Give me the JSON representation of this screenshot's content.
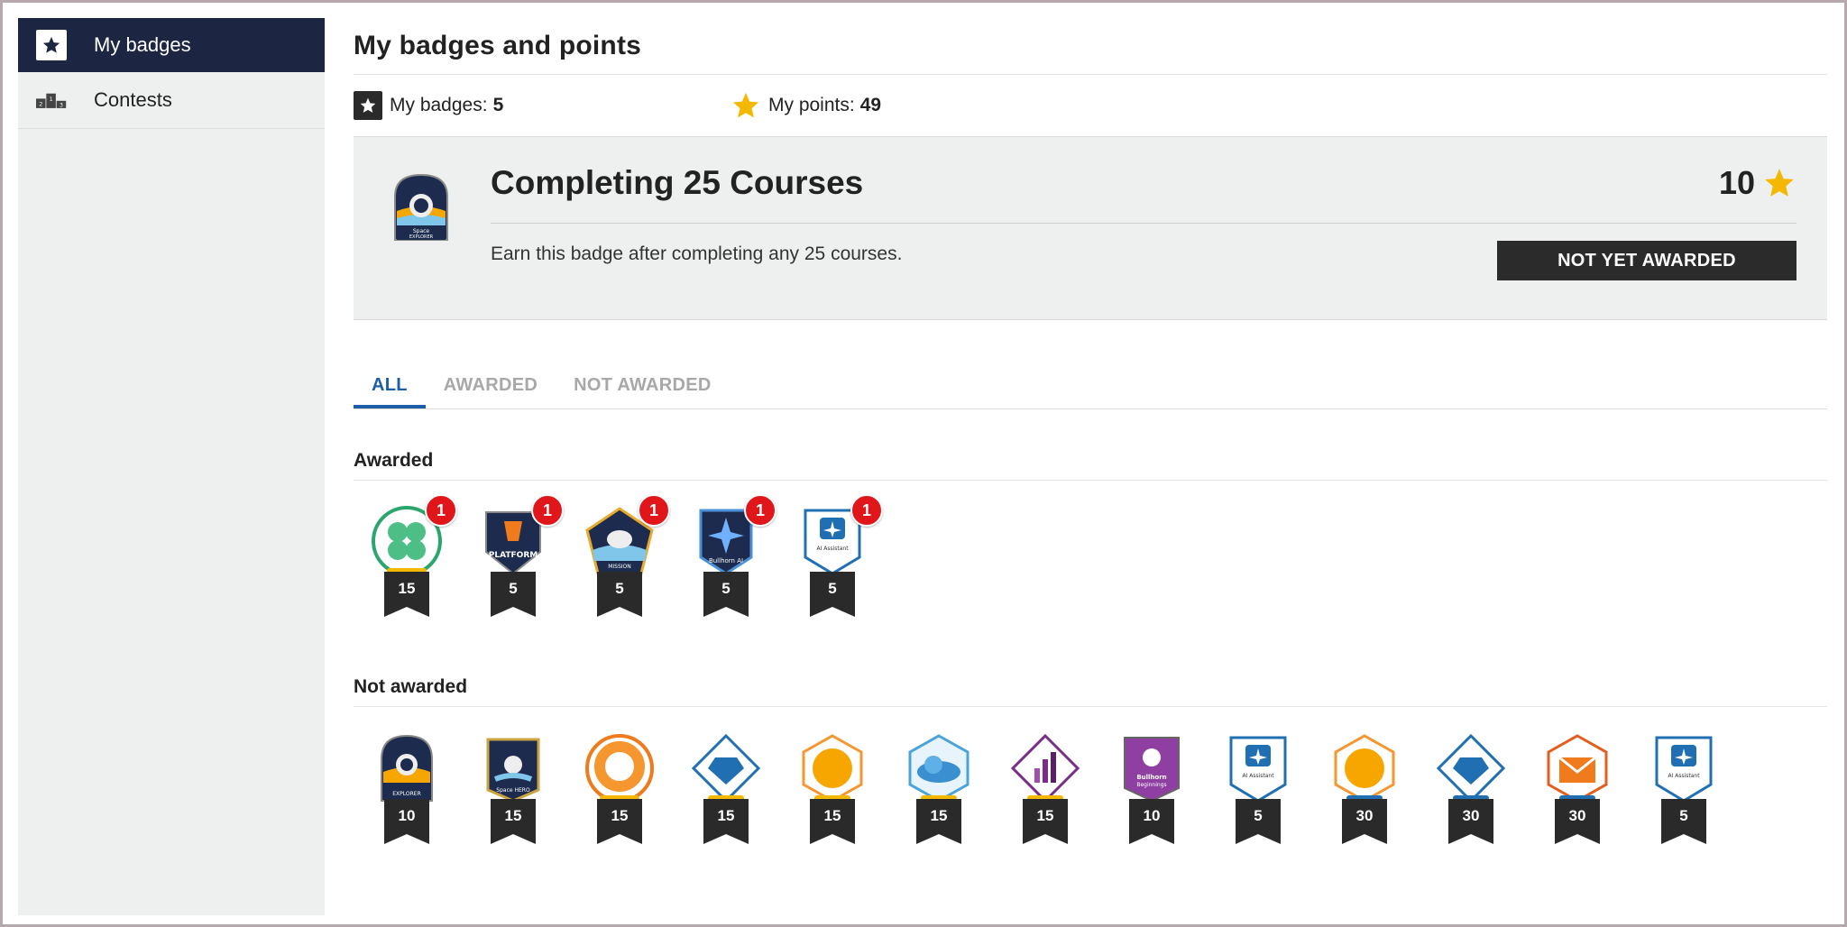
{
  "sidebar": {
    "items": [
      {
        "label": "My badges",
        "icon": "star-badge-icon",
        "active": true
      },
      {
        "label": "Contests",
        "icon": "podium-icon",
        "active": false
      }
    ]
  },
  "header": {
    "title": "My badges and points"
  },
  "stats": {
    "badges_label": "My badges:",
    "badges_value": "5",
    "points_label": "My points:",
    "points_value": "49"
  },
  "selected_badge": {
    "title": "Completing 25 Courses",
    "description": "Earn this badge after completing any 25 courses.",
    "points": "10",
    "status_button": "NOT YET AWARDED"
  },
  "tabs": [
    {
      "label": "ALL",
      "active": true
    },
    {
      "label": "AWARDED",
      "active": false
    },
    {
      "label": "NOT AWARDED",
      "active": false
    }
  ],
  "awarded": {
    "title": "Awarded",
    "badges": [
      {
        "name": "green-flower-badge",
        "points": "15",
        "count": "1"
      },
      {
        "name": "platform-badge",
        "points": "5",
        "count": "1"
      },
      {
        "name": "first-mission-badge",
        "points": "5",
        "count": "1"
      },
      {
        "name": "bullhorn-ai-badge",
        "points": "5",
        "count": "1"
      },
      {
        "name": "ai-assistant-ats-badge",
        "points": "5",
        "count": "1"
      }
    ]
  },
  "not_awarded": {
    "title": "Not awarded",
    "badges": [
      {
        "name": "space-explorer-badge",
        "points": "10"
      },
      {
        "name": "space-hero-badge",
        "points": "15"
      },
      {
        "name": "orange-ring-badge",
        "points": "15"
      },
      {
        "name": "blue-diamond-badge",
        "points": "15"
      },
      {
        "name": "orange-hexagon-badge",
        "points": "15"
      },
      {
        "name": "cloud-badge",
        "points": "15"
      },
      {
        "name": "analytics-badge",
        "points": "15"
      },
      {
        "name": "bullhorn-beginnings-badge",
        "points": "10"
      },
      {
        "name": "ai-assistant-salesforce-badge",
        "points": "5"
      },
      {
        "name": "orange-hexagon-certified-badge",
        "points": "30"
      },
      {
        "name": "blue-diamond-certified-badge",
        "points": "30"
      },
      {
        "name": "envelope-certified-badge",
        "points": "30"
      },
      {
        "name": "ai-assistant-generic-badge",
        "points": "5"
      }
    ]
  },
  "colors": {
    "sidebar_active": "#1c2541",
    "tab_active": "#1d5ea8",
    "star": "#f5b800",
    "notification": "#e0161b",
    "ribbon": "#2a2a2a"
  }
}
